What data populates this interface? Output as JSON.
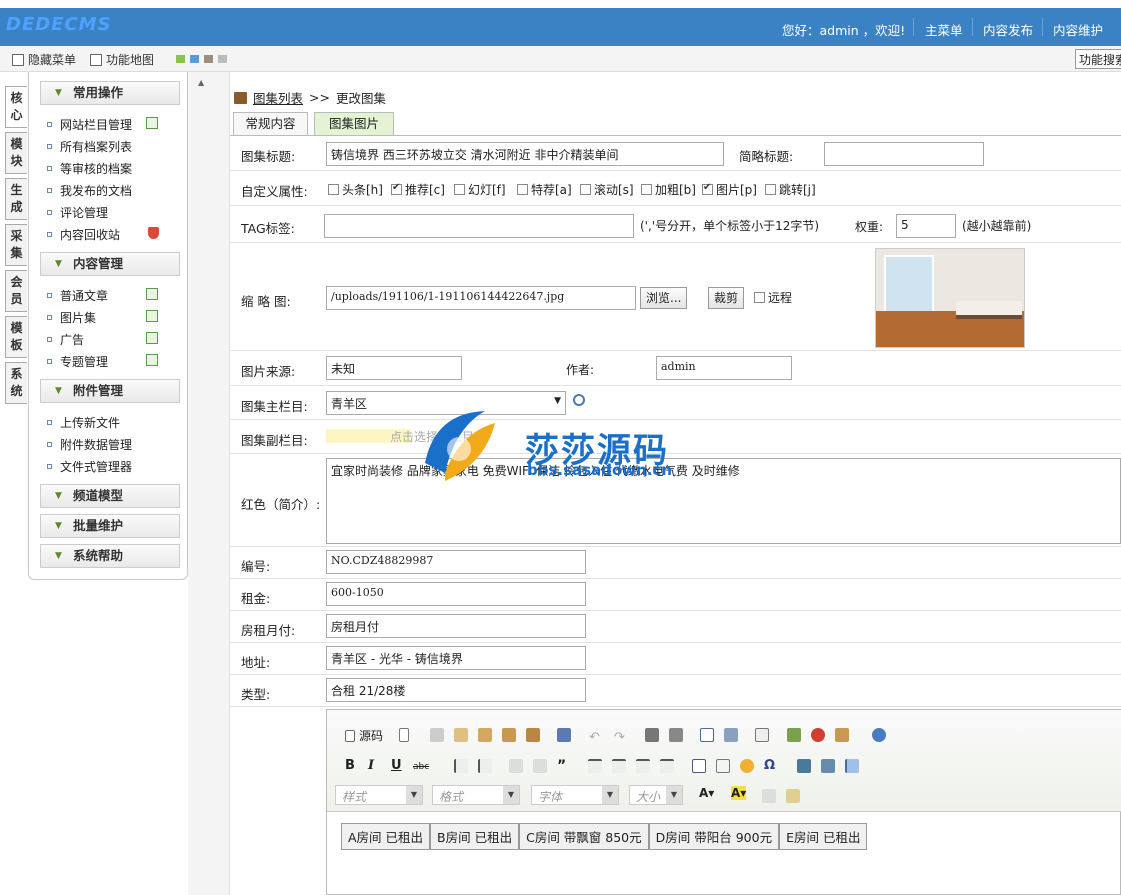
{
  "header": {
    "logo_text": "DEDECMS",
    "welcome": "您好：admin ，欢迎!",
    "nav": [
      "主菜单",
      "内容发布",
      "内容维护"
    ]
  },
  "toolbar": {
    "hide_menu": "隐藏菜单",
    "func_map": "功能地图",
    "search_btn": "功能搜索"
  },
  "vtabs": [
    {
      "label": "核心",
      "active": true
    },
    {
      "label": "模块"
    },
    {
      "label": "生成"
    },
    {
      "label": "采集"
    },
    {
      "label": "会员"
    },
    {
      "label": "模板"
    },
    {
      "label": "系统"
    }
  ],
  "sidebar": {
    "groups": [
      {
        "title": "常用操作",
        "items": [
          "网站栏目管理",
          "所有档案列表",
          "等审核的档案",
          "我发布的文档",
          "评论管理",
          "内容回收站"
        ]
      },
      {
        "title": "内容管理",
        "items": [
          "普通文章",
          "图片集",
          "广告",
          "专题管理"
        ]
      },
      {
        "title": "附件管理",
        "items": [
          "上传新文件",
          "附件数据管理",
          "文件式管理器"
        ]
      },
      {
        "title": "频道模型",
        "items": []
      },
      {
        "title": "批量维护",
        "items": []
      },
      {
        "title": "系统帮助",
        "items": []
      }
    ]
  },
  "main": {
    "breadcrumb_link": "图集列表",
    "breadcrumb_sep": ">>",
    "breadcrumb_current": "更改图集",
    "tabs": [
      "常规内容",
      "图集图片"
    ],
    "fields": {
      "title_label": "图集标题:",
      "title_value": "铸信境界 西三环苏坡立交 清水河附近 非中介精装单间",
      "short_title_label": "简略标题:",
      "short_title_value": "",
      "attr_label": "自定义属性:",
      "attrs": [
        {
          "label": "头条[h]",
          "checked": false
        },
        {
          "label": "推荐[c]",
          "checked": true
        },
        {
          "label": "幻灯[f]",
          "checked": false
        },
        {
          "label": "特荐[a]",
          "checked": false
        },
        {
          "label": "滚动[s]",
          "checked": false
        },
        {
          "label": "加粗[b]",
          "checked": false
        },
        {
          "label": "图片[p]",
          "checked": true
        },
        {
          "label": "跳转[j]",
          "checked": false
        }
      ],
      "tag_label": "TAG标签:",
      "tag_value": "",
      "tag_hint": "(','号分开，单个标签小于12字节)",
      "weight_label": "权重:",
      "weight_value": "5",
      "weight_hint": "(越小越靠前)",
      "thumb_label": "缩 略 图:",
      "thumb_value": "/uploads/191106/1-191106144422647.jpg",
      "browse_btn": "浏览...",
      "crop_btn": "裁剪",
      "remote_label": "远程",
      "source_label": "图片来源:",
      "source_value": "未知",
      "author_label": "作者:",
      "author_value": "admin",
      "main_col_label": "图集主栏目:",
      "main_col_value": "青羊区",
      "sub_col_label": "图集副栏目:",
      "sub_col_pick": "点击选择副栏目",
      "desc_label": "红色（简介）:",
      "desc_value": "宜家时尚装修 品牌家具家电 免费WIFI 保洁 拎包入住 代缴水电气费 及时维修",
      "code_label": "编号:",
      "code_value": "NO.CDZ48829987",
      "rent_label": "租金:",
      "rent_value": "600-1050",
      "pay_label": "房租月付:",
      "pay_value": "房租月付",
      "addr_label": "地址:",
      "addr_value": "青羊区 - 光华 - 铸信境界",
      "type_label": "类型:",
      "type_value": "合租 21/28楼"
    },
    "editor": {
      "source_label": "源码",
      "combos": [
        "样式",
        "格式",
        "字体",
        "大小"
      ],
      "rooms": [
        "A房间 已租出",
        "B房间 已租出",
        "C房间 带飘窗 850元",
        "D房间 带阳台 900元",
        "E房间 已租出"
      ]
    }
  },
  "watermark": {
    "title": "莎莎源码",
    "url": "bbs.sasadown.cn"
  }
}
